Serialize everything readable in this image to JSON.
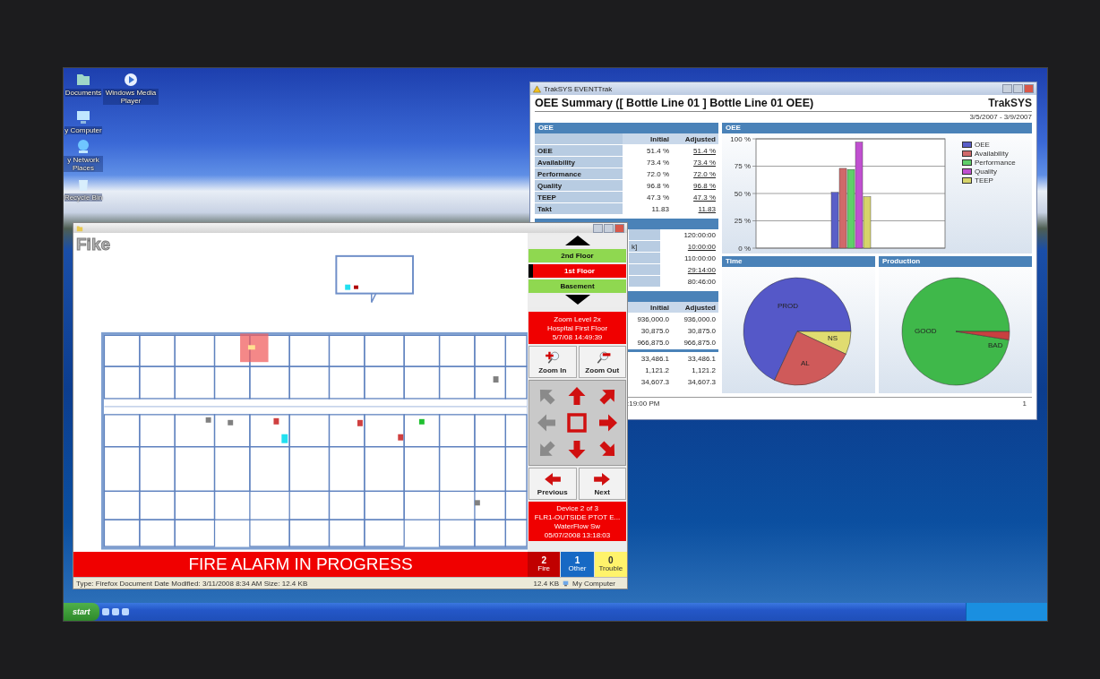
{
  "desktop": {
    "icons": [
      {
        "kind": "documents",
        "label": "Documents"
      },
      {
        "kind": "media",
        "label": "Windows Media Player"
      },
      {
        "kind": "computer",
        "label": "y Computer"
      },
      {
        "kind": "network",
        "label": "y Network Places"
      },
      {
        "kind": "recycle",
        "label": "Recycle Bin"
      }
    ]
  },
  "traksys_window": {
    "title": "TrakSYS EVENTTrak",
    "heading": "OEE Summary ([ Bottle Line 01 ] Bottle Line 01 OEE)",
    "logo": "TrakSYS",
    "date_range": "3/5/2007 - 3/9/2007",
    "oee_table": {
      "title": "OEE",
      "columns": [
        "Initial",
        "Adjusted"
      ],
      "rows": [
        {
          "label": "OEE",
          "initial": "51.4 %",
          "adjusted": "51.4 %",
          "linked": true
        },
        {
          "label": "Availability",
          "initial": "73.4 %",
          "adjusted": "73.4 %",
          "linked": true
        },
        {
          "label": "Performance",
          "initial": "72.0 %",
          "adjusted": "72.0 %",
          "linked": true
        },
        {
          "label": "Quality",
          "initial": "96.8 %",
          "adjusted": "96.8 %",
          "linked": true
        },
        {
          "label": "TEEP",
          "initial": "47.3 %",
          "adjusted": "47.3 %",
          "linked": true
        },
        {
          "label": "Takt",
          "initial": "11.83",
          "adjusted": "11.83",
          "linked": true
        }
      ]
    },
    "time_table": {
      "rows": [
        {
          "value": "120:00:00",
          "linked": false
        },
        {
          "label": "k]",
          "value": "10:00:00",
          "linked": true
        },
        {
          "value": "110:00:00",
          "linked": false
        },
        {
          "value": "29:14:00",
          "linked": true
        },
        {
          "value": "80:46:00",
          "linked": false
        }
      ]
    },
    "count_table": {
      "columns": [
        "Initial",
        "Adjusted"
      ],
      "groups": [
        [
          {
            "initial": "936,000.0",
            "adjusted": "936,000.0"
          },
          {
            "initial": "30,875.0",
            "adjusted": "30,875.0"
          },
          {
            "initial": "966,875.0",
            "adjusted": "966,875.0"
          }
        ],
        [
          {
            "initial": "33,486.1",
            "adjusted": "33,486.1"
          },
          {
            "initial": "1,121.2",
            "adjusted": "1,121.2"
          },
          {
            "initial": "34,607.3",
            "adjusted": "34,607.3"
          }
        ]
      ]
    },
    "oee_chart": {
      "title": "OEE",
      "chart_data": {
        "type": "bar",
        "grid": true,
        "ylim": [
          0,
          100
        ],
        "yticks": [
          {
            "value": 0,
            "label": "0 %"
          },
          {
            "value": 25,
            "label": "25 %"
          },
          {
            "value": 50,
            "label": "50 %"
          },
          {
            "value": 75,
            "label": "75 %"
          },
          {
            "value": 100,
            "label": "100 %"
          }
        ],
        "series": [
          {
            "name": "OEE",
            "color": "#5a5fc8",
            "values": [
              51
            ]
          },
          {
            "name": "Availability",
            "color": "#d0696a",
            "values": [
              73
            ]
          },
          {
            "name": "Performance",
            "color": "#5fcf6a",
            "values": [
              72
            ]
          },
          {
            "name": "Quality",
            "color": "#c050d0",
            "values": [
              97
            ]
          },
          {
            "name": "TEEP",
            "color": "#d6d46a",
            "values": [
              47
            ]
          }
        ]
      }
    },
    "time_chart": {
      "title": "Time",
      "labels": [
        "PROD",
        "NS",
        "AL"
      ]
    },
    "production_chart": {
      "title": "Production",
      "labels": [
        "GOOD",
        "BAD"
      ]
    },
    "footer": {
      "time": ":19:00 PM",
      "page": "1"
    }
  },
  "fike_window": {
    "logo": "Fike",
    "floors": [
      {
        "label": "2nd Floor",
        "selected": false
      },
      {
        "label": "1st Floor",
        "selected": true
      },
      {
        "label": "Basement",
        "selected": false
      }
    ],
    "zoom_info": [
      "Zoom Level 2x",
      "Hospital First Floor",
      "5/7/08 14:49:39"
    ],
    "zoom_buttons": [
      {
        "kind": "in",
        "label": "Zoom In"
      },
      {
        "kind": "out",
        "label": "Zoom Out"
      }
    ],
    "pan_pad": [
      {
        "kind": "arrow",
        "disabled": true
      },
      {
        "kind": "arrow",
        "disabled": false
      },
      {
        "kind": "arrow",
        "disabled": false
      },
      {
        "kind": "arrow",
        "disabled": true
      },
      {
        "kind": "center",
        "disabled": false
      },
      {
        "kind": "arrow",
        "disabled": false
      },
      {
        "kind": "arrow",
        "disabled": true
      },
      {
        "kind": "arrow",
        "disabled": false
      },
      {
        "kind": "arrow",
        "disabled": false
      }
    ],
    "nav_buttons": [
      {
        "kind": "previous",
        "label": "Previous"
      },
      {
        "kind": "next",
        "label": "Next"
      }
    ],
    "device_info": [
      "Device 2 of 3",
      "FLR1-OUTSIDE PTOT E...",
      "WaterFlow Sw",
      "05/07/2008 13:18:03"
    ],
    "alarm_banner": "FIRE ALARM IN PROGRESS",
    "counters": [
      {
        "kind": "fire",
        "count": "2",
        "label": "Fire",
        "color": "#c00000"
      },
      {
        "kind": "other",
        "count": "1",
        "label": "Other",
        "color": "#1769c4"
      },
      {
        "kind": "trouble",
        "count": "0",
        "label": "Trouble",
        "color": "#fff36b"
      }
    ],
    "status_bar": {
      "text": "Type: Firefox Document Date Modified: 3/11/2008 8:34 AM Size: 12.4 KB",
      "size": "12.4 KB",
      "zone": "My Computer"
    }
  },
  "taskbar": {
    "start": "start"
  }
}
